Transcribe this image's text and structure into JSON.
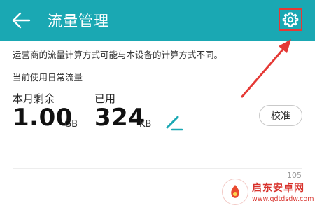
{
  "header": {
    "title": "流量管理",
    "back_icon": "back-arrow-icon",
    "settings_icon": "gear-icon",
    "background": "#1aa8b3"
  },
  "notice": "运营商的流量计算方式可能与本设备的计算方式不同。",
  "plan": "当前使用日常流量",
  "remaining": {
    "label": "本月剩余",
    "value": "1.00",
    "unit": "GB"
  },
  "used": {
    "label": "已用",
    "value": "324",
    "unit": "KB"
  },
  "edit_icon": "pencil-icon",
  "calibrate_label": "校准",
  "stat_value": "105",
  "annotation": {
    "color": "#e53935"
  },
  "watermark": {
    "title": "启东安卓网",
    "url": "www.qdtdsdw.com",
    "color": "#d8322c"
  }
}
